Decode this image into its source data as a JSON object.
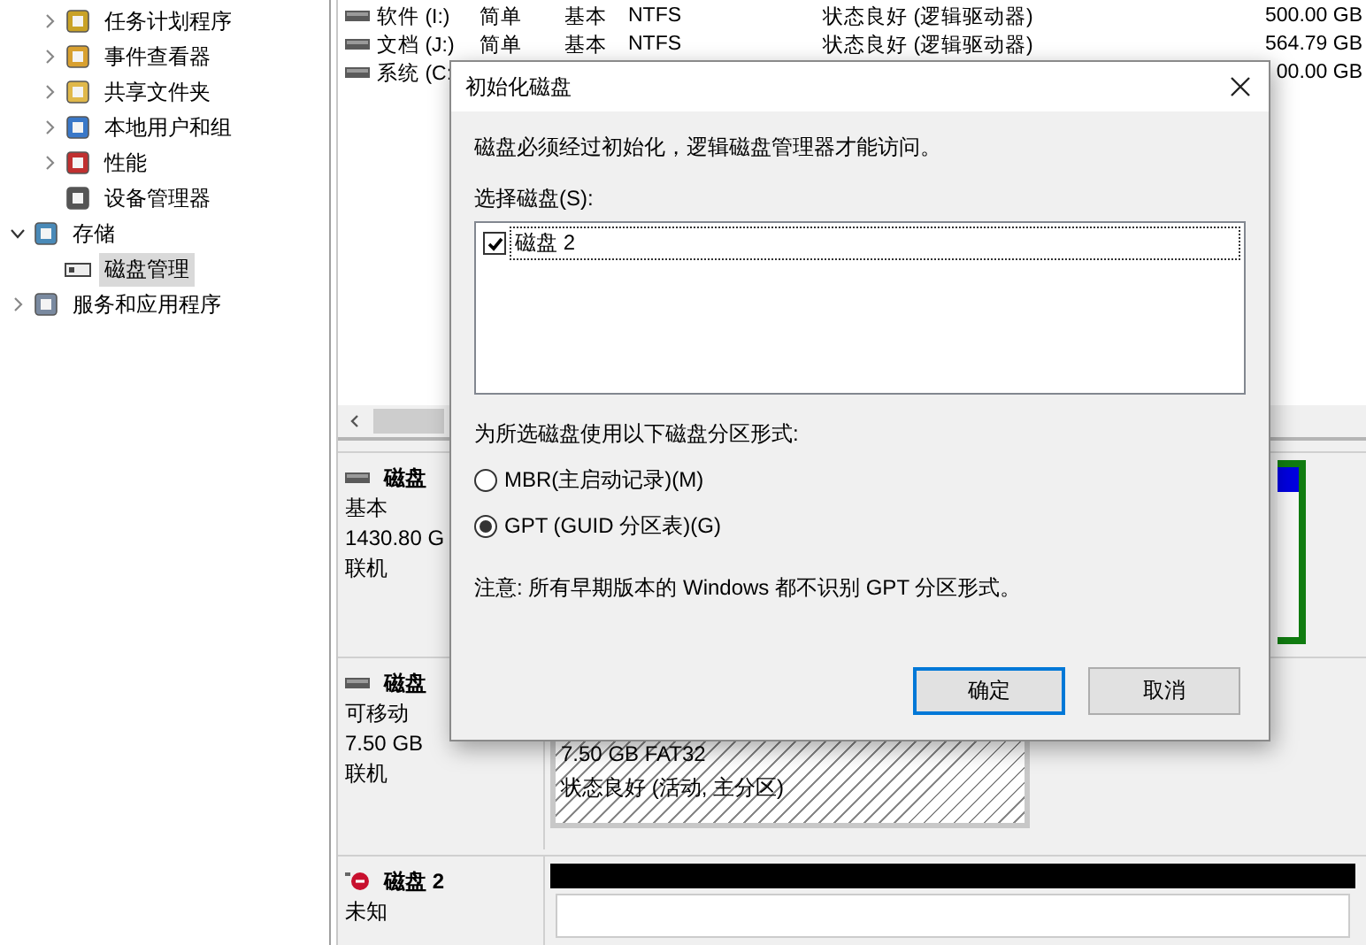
{
  "tree": {
    "upper_items": [
      {
        "label": "任务计划程序",
        "expanded": false,
        "selected": false
      },
      {
        "label": "事件查看器",
        "expanded": false,
        "selected": false
      },
      {
        "label": "共享文件夹",
        "expanded": false,
        "selected": false
      },
      {
        "label": "本地用户和组",
        "expanded": false,
        "selected": false
      },
      {
        "label": "性能",
        "expanded": false,
        "selected": false
      },
      {
        "label": "设备管理器",
        "selected": false
      }
    ],
    "items": [
      {
        "label": "存储",
        "expanded": true,
        "selected": false,
        "children": [
          {
            "label": "磁盘管理",
            "selected": true
          }
        ]
      },
      {
        "label": "服务和应用程序",
        "expanded": false,
        "selected": false
      }
    ]
  },
  "volumes": [
    {
      "name": "软件 (I:)",
      "layout": "简单",
      "type": "基本",
      "fs": "NTFS",
      "status": "状态良好 (逻辑驱动器)",
      "capacity": "500.00 GB"
    },
    {
      "name": "文档 (J:)",
      "layout": "简单",
      "type": "基本",
      "fs": "NTFS",
      "status": "状态良好 (逻辑驱动器)",
      "capacity": "564.79 GB"
    },
    {
      "name": "系统 (C:",
      "capacity": "00.00 GB"
    }
  ],
  "disks": [
    {
      "kind": "basic",
      "name": "磁盘",
      "type": "基本",
      "size": "1430.80 G",
      "status": "联机",
      "partition": {
        "kind": "edge"
      }
    },
    {
      "kind": "removable",
      "name": "磁盘",
      "type": "可移动",
      "size": "7.50 GB",
      "status": "联机",
      "partition": {
        "kind": "hatched",
        "size_fs": "7.50 GB FAT32",
        "status": "状态良好 (活动, 主分区)"
      }
    },
    {
      "kind": "unknown",
      "name": "磁盘 2",
      "type": "未知",
      "partition": {
        "kind": "unallocated"
      }
    }
  ],
  "dialog": {
    "title": "初始化磁盘",
    "message": "磁盘必须经过初始化，逻辑磁盘管理器才能访问。",
    "select_label": "选择磁盘(S):",
    "disks": [
      {
        "label": "磁盘 2",
        "checked": true,
        "selected": true
      }
    ],
    "format_label": "为所选磁盘使用以下磁盘分区形式:",
    "options": [
      {
        "label": "MBR(主启动记录)(M)",
        "selected": false
      },
      {
        "label": "GPT (GUID 分区表)(G)",
        "selected": true
      }
    ],
    "note": "注意: 所有早期版本的 Windows 都不识别 GPT 分区形式。",
    "buttons": [
      {
        "label": "确定",
        "default": true
      },
      {
        "label": "取消",
        "default": false
      }
    ]
  }
}
